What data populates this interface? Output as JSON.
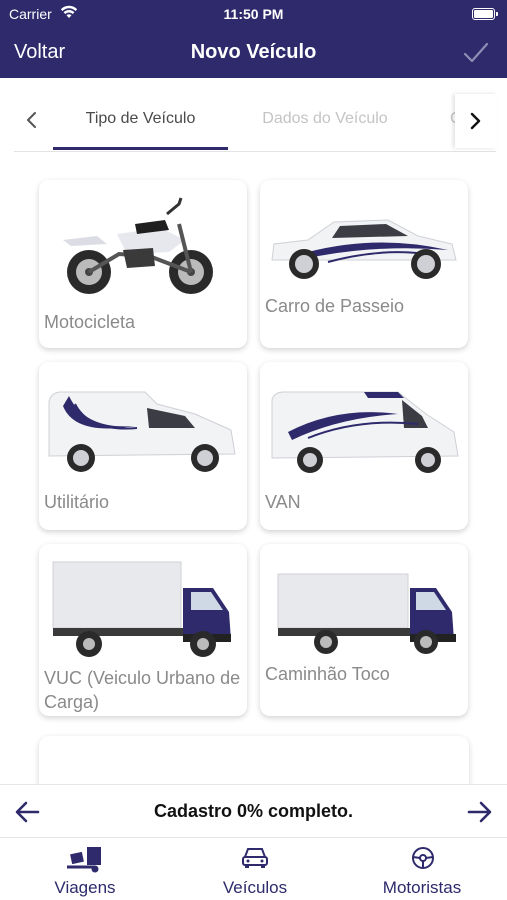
{
  "status_bar": {
    "carrier": "Carrier",
    "time": "11:50 PM"
  },
  "nav": {
    "back_label": "Voltar",
    "title": "Novo Veículo",
    "confirm_icon": "checkmark-icon"
  },
  "tabs": {
    "items": [
      {
        "label": "Tipo de Veículo",
        "active": true
      },
      {
        "label": "Dados do Veículo",
        "active": false
      },
      {
        "label": "C",
        "active": false
      }
    ]
  },
  "vehicles": [
    {
      "label": "Motocicleta",
      "icon": "motorcycle-image"
    },
    {
      "label": "Carro de Passeio",
      "icon": "car-image"
    },
    {
      "label": "Utilitário",
      "icon": "utility-van-image"
    },
    {
      "label": "VAN",
      "icon": "van-image"
    },
    {
      "label": "VUC (Veiculo Urbano de Carga)",
      "icon": "light-truck-image"
    },
    {
      "label": "Caminhão Toco",
      "icon": "truck-image"
    }
  ],
  "progress": {
    "text": "Cadastro 0% completo.",
    "percent": 0
  },
  "tab_bar": {
    "items": [
      {
        "label": "Viagens",
        "icon": "truck-loading-icon"
      },
      {
        "label": "Veículos",
        "icon": "car-front-icon"
      },
      {
        "label": "Motoristas",
        "icon": "steering-wheel-icon"
      }
    ]
  },
  "colors": {
    "brand": "#2e2a6b",
    "inactive_text": "#c4c4c4",
    "card_label": "#8a8a8a"
  }
}
